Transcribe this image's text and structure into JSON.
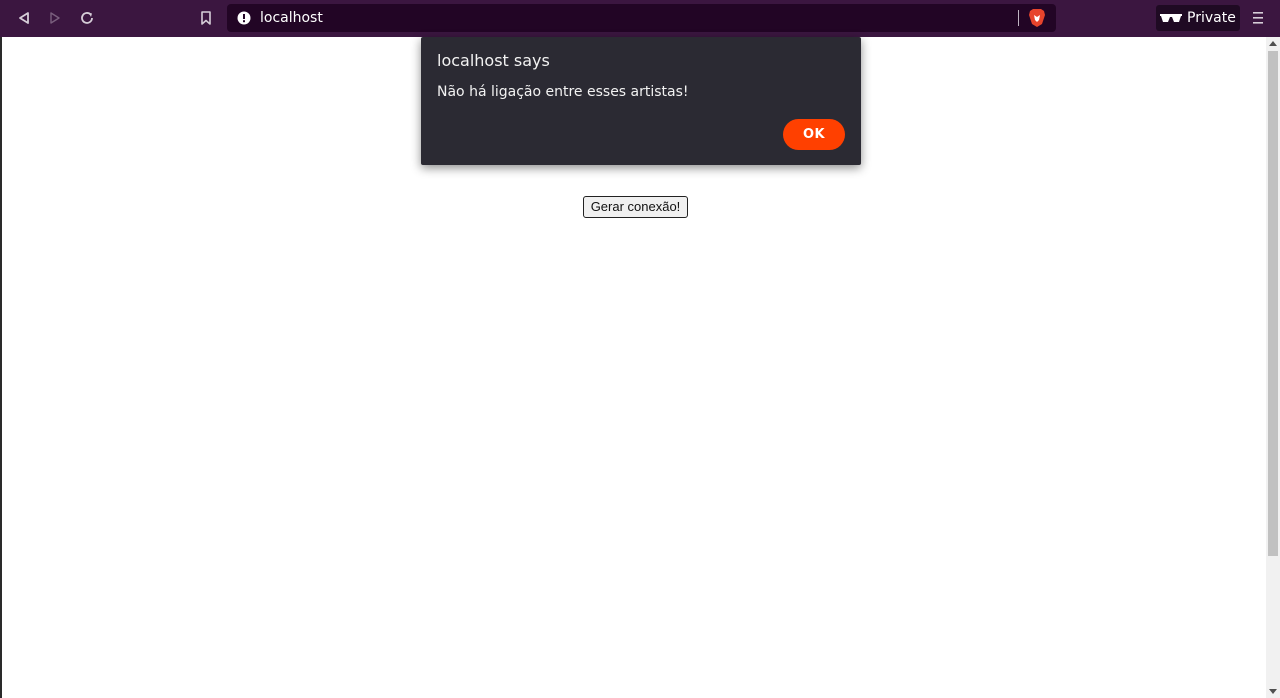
{
  "browser": {
    "url": "localhost",
    "private_label": "Private",
    "icons": {
      "back": "back-arrow-icon",
      "forward": "forward-arrow-icon",
      "reload": "reload-icon",
      "bookmark": "bookmark-icon",
      "site_info": "site-info-icon",
      "shields": "brave-shields-icon",
      "private": "private-glasses-icon",
      "menu": "hamburger-menu-icon"
    },
    "colors": {
      "toolbar": "#3b1640",
      "urlbar": "#220525",
      "shields": "#e7442c"
    }
  },
  "page": {
    "button_label": "Gerar conexão!"
  },
  "dialog": {
    "title": "localhost says",
    "message": "Não há ligação entre esses artistas!",
    "ok_label": "OK",
    "colors": {
      "background": "#2b2a33",
      "ok_button": "#ff4000"
    }
  }
}
